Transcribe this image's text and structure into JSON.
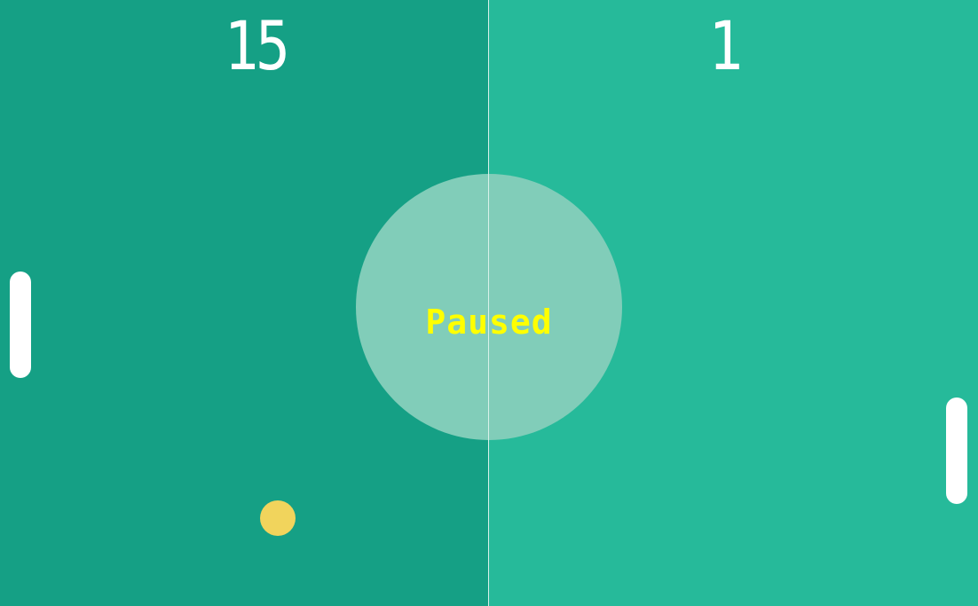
{
  "game": {
    "title": "",
    "status_text": "Paused",
    "colors": {
      "left_half": "#15a085",
      "right_half": "#26ba9a",
      "center_circle": "#81cdb9",
      "paddle": "#ffffff",
      "ball": "#f1d45c",
      "status_text": "#ffff00",
      "score_text": "#ffffff"
    }
  },
  "scores": {
    "left": "15",
    "right": "1"
  }
}
